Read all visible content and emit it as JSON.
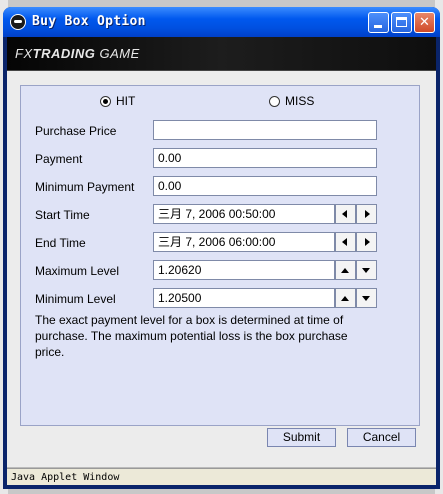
{
  "window": {
    "title": "Buy Box Option"
  },
  "banner": {
    "logo_prefix": "FX",
    "logo_bold": "TRADING",
    "logo_suffix": " GAME"
  },
  "options": {
    "hit_label": "HIT",
    "miss_label": "MISS",
    "selected": "HIT"
  },
  "form": {
    "purchase_price": {
      "label": "Purchase Price",
      "value": ""
    },
    "payment": {
      "label": "Payment",
      "value": "0.00"
    },
    "minimum_payment": {
      "label": "Minimum Payment",
      "value": "0.00"
    },
    "start_time": {
      "label": "Start Time",
      "value": "三月 7, 2006  00:50:00"
    },
    "end_time": {
      "label": "End Time",
      "value": "三月 7, 2006  06:00:00"
    },
    "maximum_level": {
      "label": "Maximum Level",
      "value": "1.20620"
    },
    "minimum_level": {
      "label": "Minimum Level",
      "value": "1.20500"
    }
  },
  "note": "The exact payment level for a box is determined at time of purchase. The maximum potential loss is the box purchase price.",
  "buttons": {
    "submit": "Submit",
    "cancel": "Cancel"
  },
  "status": "Java Applet Window",
  "icons": [
    "java-window-icon",
    "minimize-icon",
    "maximize-icon",
    "close-icon",
    "arrow-left-icon",
    "arrow-right-icon",
    "arrow-up-icon",
    "arrow-down-icon"
  ]
}
